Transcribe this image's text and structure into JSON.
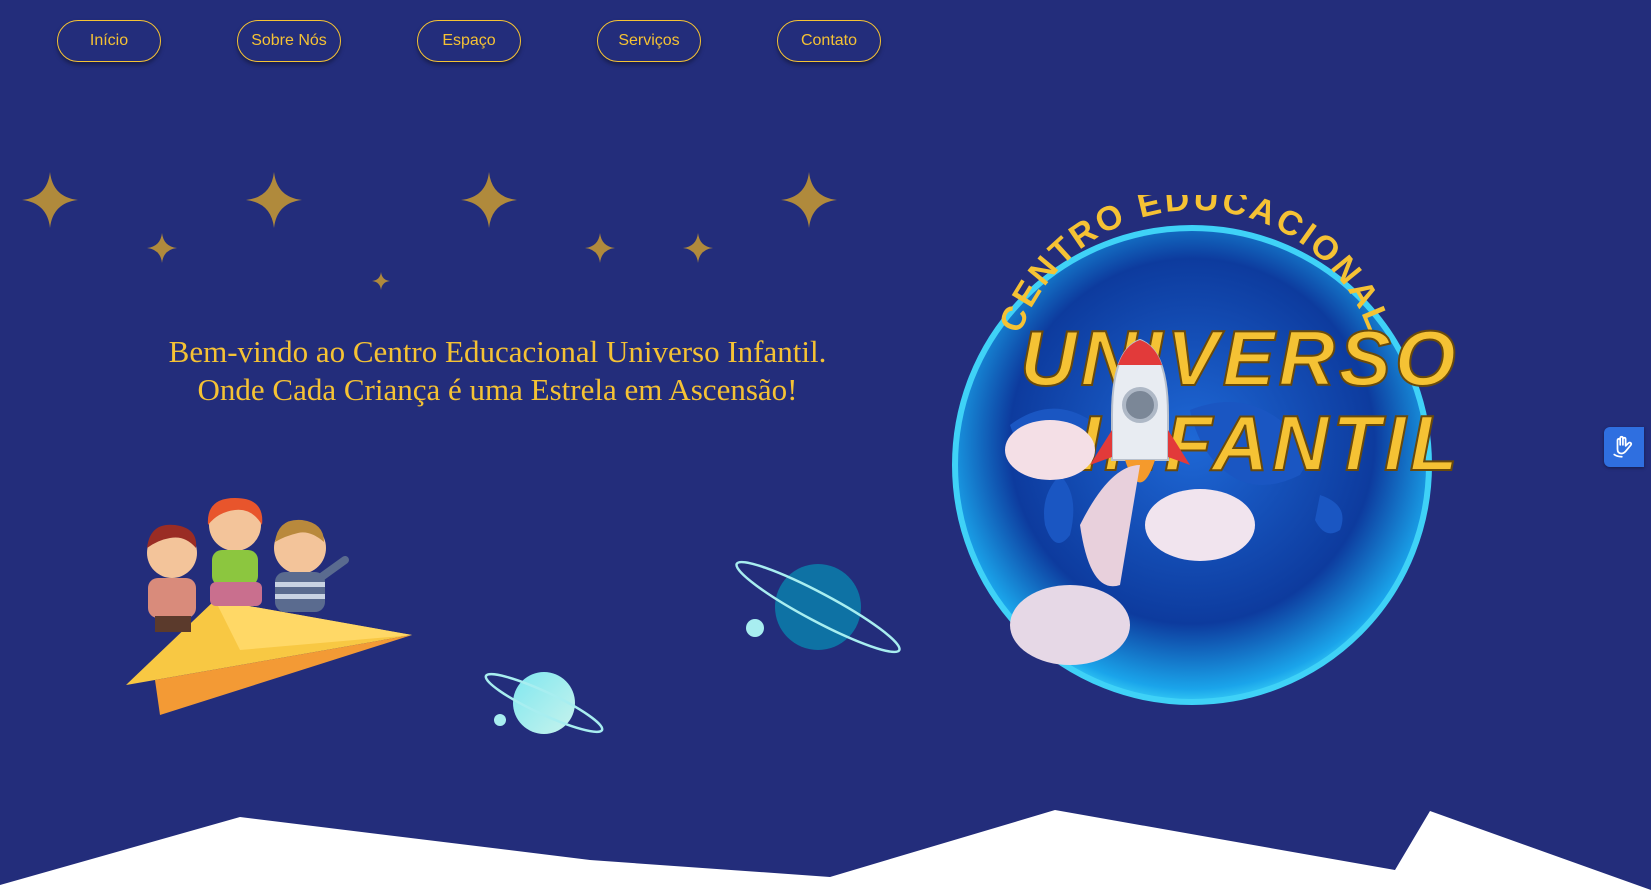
{
  "nav": {
    "items": [
      {
        "label": "Início"
      },
      {
        "label": "Sobre Nós"
      },
      {
        "label": "Espaço"
      },
      {
        "label": "Serviços"
      },
      {
        "label": "Contato"
      }
    ]
  },
  "hero": {
    "line1": "Bem-vindo ao Centro Educacional Universo Infantil.",
    "line2": "Onde Cada Criança é uma Estrela em Ascensão!"
  },
  "logo": {
    "top_text": "CENTRO EDUCACIONAL",
    "word1": "UNIVERSO",
    "word2": "INFANTIL"
  },
  "colors": {
    "background": "#232d7b",
    "accent": "#f5c234",
    "accessibility_button": "#2f6fe0"
  },
  "icons": {
    "accessibility": "sign-language-hand-icon",
    "stars": "four-point-star-icon",
    "planets": "ringed-planet-icon"
  }
}
